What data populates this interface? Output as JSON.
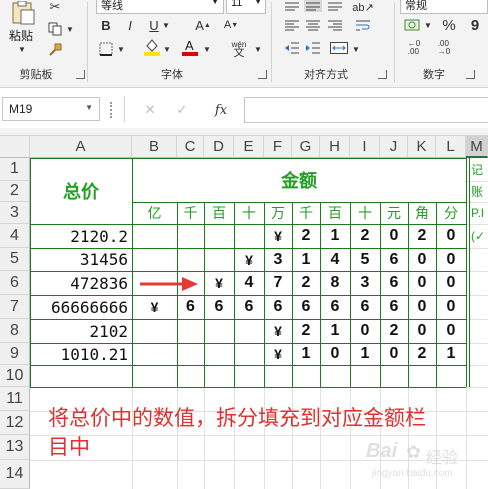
{
  "ribbon": {
    "clipboard": {
      "paste_label": "粘贴",
      "group_label": "剪贴板"
    },
    "font": {
      "font_name": "等线",
      "font_size": "11",
      "bold": "B",
      "italic": "I",
      "underline": "U",
      "grow": "A",
      "shrink": "A",
      "wen": "wén",
      "wen_sub": "文",
      "group_label": "字体"
    },
    "alignment": {
      "group_label": "对齐方式"
    },
    "number": {
      "format": "常规",
      "percent": "%",
      "comma": "9",
      "group_label": "数字"
    }
  },
  "formula_bar": {
    "name_box": "M19",
    "cancel": "✕",
    "enter": "✓",
    "fx": "fx"
  },
  "columns": [
    "A",
    "B",
    "C",
    "D",
    "E",
    "F",
    "G",
    "H",
    "I",
    "J",
    "K",
    "L",
    "M"
  ],
  "rows": [
    "1",
    "2",
    "3",
    "4",
    "5",
    "6",
    "7",
    "8",
    "9",
    "10",
    "11",
    "12",
    "13",
    "14"
  ],
  "sheet": {
    "total_header": "总价",
    "amount_header": "金额",
    "units": [
      "亿",
      "千",
      "百",
      "十",
      "万",
      "千",
      "百",
      "十",
      "元",
      "角",
      "分"
    ],
    "m_col_text": [
      "记",
      "账",
      "P.I",
      "(✓"
    ],
    "prices": [
      "2120.2",
      "31456",
      "472836",
      "66666666",
      "2102",
      "1010.21"
    ],
    "amount_rows": [
      [
        "",
        "",
        "",
        "",
        "¥",
        "2",
        "1",
        "2",
        "0",
        "2",
        "0"
      ],
      [
        "",
        "",
        "",
        "¥",
        "3",
        "1",
        "4",
        "5",
        "6",
        "0",
        "0"
      ],
      [
        "",
        "",
        "¥",
        "4",
        "7",
        "2",
        "8",
        "3",
        "6",
        "0",
        "0"
      ],
      [
        "¥",
        "6",
        "6",
        "6",
        "6",
        "6",
        "6",
        "6",
        "6",
        "0",
        "0"
      ],
      [
        "",
        "",
        "",
        "",
        "¥",
        "2",
        "1",
        "0",
        "2",
        "0",
        "0"
      ],
      [
        "",
        "",
        "",
        "",
        "¥",
        "1",
        "0",
        "1",
        "0",
        "2",
        "1"
      ]
    ],
    "note_line1": "将总价中的数值，拆分填充到对应金额栏",
    "note_line2": "目中"
  },
  "colors": {
    "green_border": "#1e7a1e",
    "header_green": "#22a022",
    "note_red": "#e03030",
    "arrow_red": "#e53935"
  },
  "watermark": {
    "text1": "Bai",
    "text2": "经验",
    "text3": "jingyan.baidu.com"
  }
}
